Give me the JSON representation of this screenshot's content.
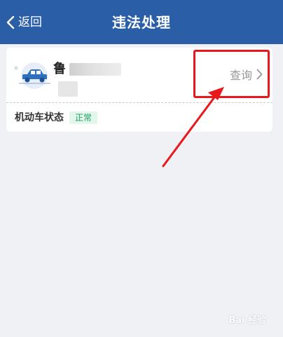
{
  "header": {
    "back_label": "返回",
    "title": "违法处理"
  },
  "vehicle": {
    "plate_prefix": "鲁",
    "query_label": "查询",
    "status_label": "机动车状态",
    "status_value": "正常"
  },
  "watermark": {
    "text": "Bai 经验"
  },
  "colors": {
    "header_bg": "#2a5fa8",
    "annotation_red": "#e8181c",
    "status_green": "#1fa060",
    "status_bg": "#e3f6ec",
    "car_blue": "#2f6fbf"
  },
  "icons": {
    "back": "chevron-left-icon",
    "car": "car-icon",
    "query_arrow": "chevron-right-icon"
  }
}
